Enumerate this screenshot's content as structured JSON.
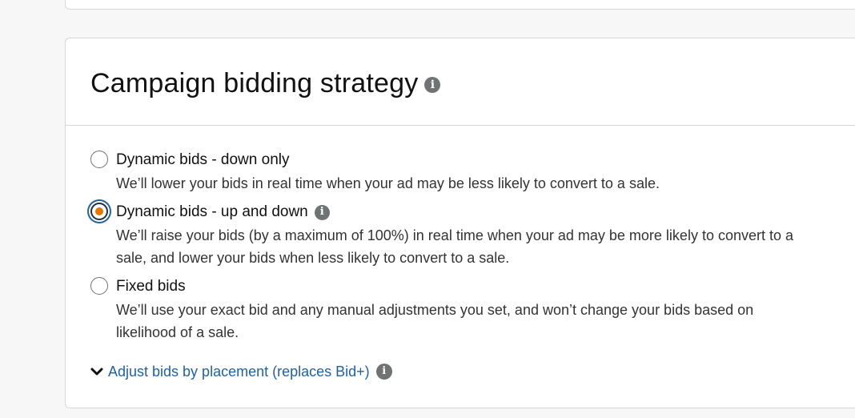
{
  "card": {
    "title": "Campaign bidding strategy",
    "title_info_icon": "info-icon"
  },
  "options": [
    {
      "label": "Dynamic bids - down only",
      "description": "We’ll lower your bids in real time when your ad may be less likely to convert to a sale.",
      "selected": false,
      "has_info": false
    },
    {
      "label": "Dynamic bids - up and down",
      "description": "We’ll raise your bids (by a maximum of 100%) in real time when your ad may be more likely to convert to a sale, and lower your bids when less likely to convert to a sale.",
      "selected": true,
      "has_info": true
    },
    {
      "label": "Fixed bids",
      "description": "We’ll use your exact bid and any manual adjustments you set, and won’t change your bids based on likelihood of a sale.",
      "selected": false,
      "has_info": false
    }
  ],
  "adjust_link": {
    "label": "Adjust bids by placement (replaces Bid+)",
    "icon": "chevron-down-icon"
  },
  "colors": {
    "link": "#2162a1",
    "radio_selected_dot": "#e77600",
    "focus_ring": "#2162a1",
    "info_icon": "#6f7373"
  }
}
